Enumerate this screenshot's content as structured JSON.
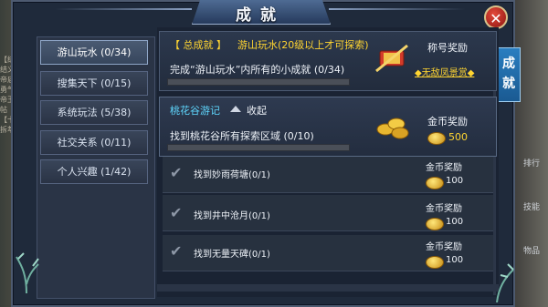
{
  "window": {
    "title": "成就",
    "close_label": "✕"
  },
  "side_tab": {
    "label": "成就"
  },
  "categories": [
    {
      "label": "游山玩水 (0/34)",
      "active": true
    },
    {
      "label": "搜集天下 (0/15)",
      "active": false
    },
    {
      "label": "系统玩法 (5/38)",
      "active": false
    },
    {
      "label": "社交关系 (0/11)",
      "active": false
    },
    {
      "label": "个人兴趣 (1/42)",
      "active": false
    }
  ],
  "summary_card": {
    "tag": "【 总成就 】",
    "title": "游山玩水(20级以上才可探索)",
    "desc": "完成“游山玩水”内所有的小成就 (0/34)",
    "progress": 0,
    "reward_title": "称号奖励",
    "reward_value": "◆无敌凤景赏◆"
  },
  "group_card": {
    "name": "桃花谷游记",
    "toggle_label": "收起",
    "desc": "找到桃花谷所有探索区域 (0/10)",
    "progress": 0,
    "reward_title": "金币奖励",
    "reward_amount": "500"
  },
  "sub_items": [
    {
      "title": "找到妙雨荷塘(0/1)",
      "reward_title": "金币奖励",
      "reward_amount": "100"
    },
    {
      "title": "找到井中沧月(0/1)",
      "reward_title": "金币奖励",
      "reward_amount": "100"
    },
    {
      "title": "找到无量天碑(0/1)",
      "reward_title": "金币奖励",
      "reward_amount": "100"
    }
  ],
  "background_text": {
    "left_lines": [
      "【结义】",
      "结义阵",
      "帝庙马",
      "勇气号",
      "帝王身",
      "帖",
      "【十四】",
      "拆萃鲜"
    ],
    "right_items": [
      "排行",
      "技能",
      "物品"
    ]
  },
  "colors": {
    "accent_yellow": "#ffd531",
    "accent_cyan": "#5fd8ff",
    "close_red": "#c8281c",
    "side_tab_blue": "#1f6aa8"
  }
}
